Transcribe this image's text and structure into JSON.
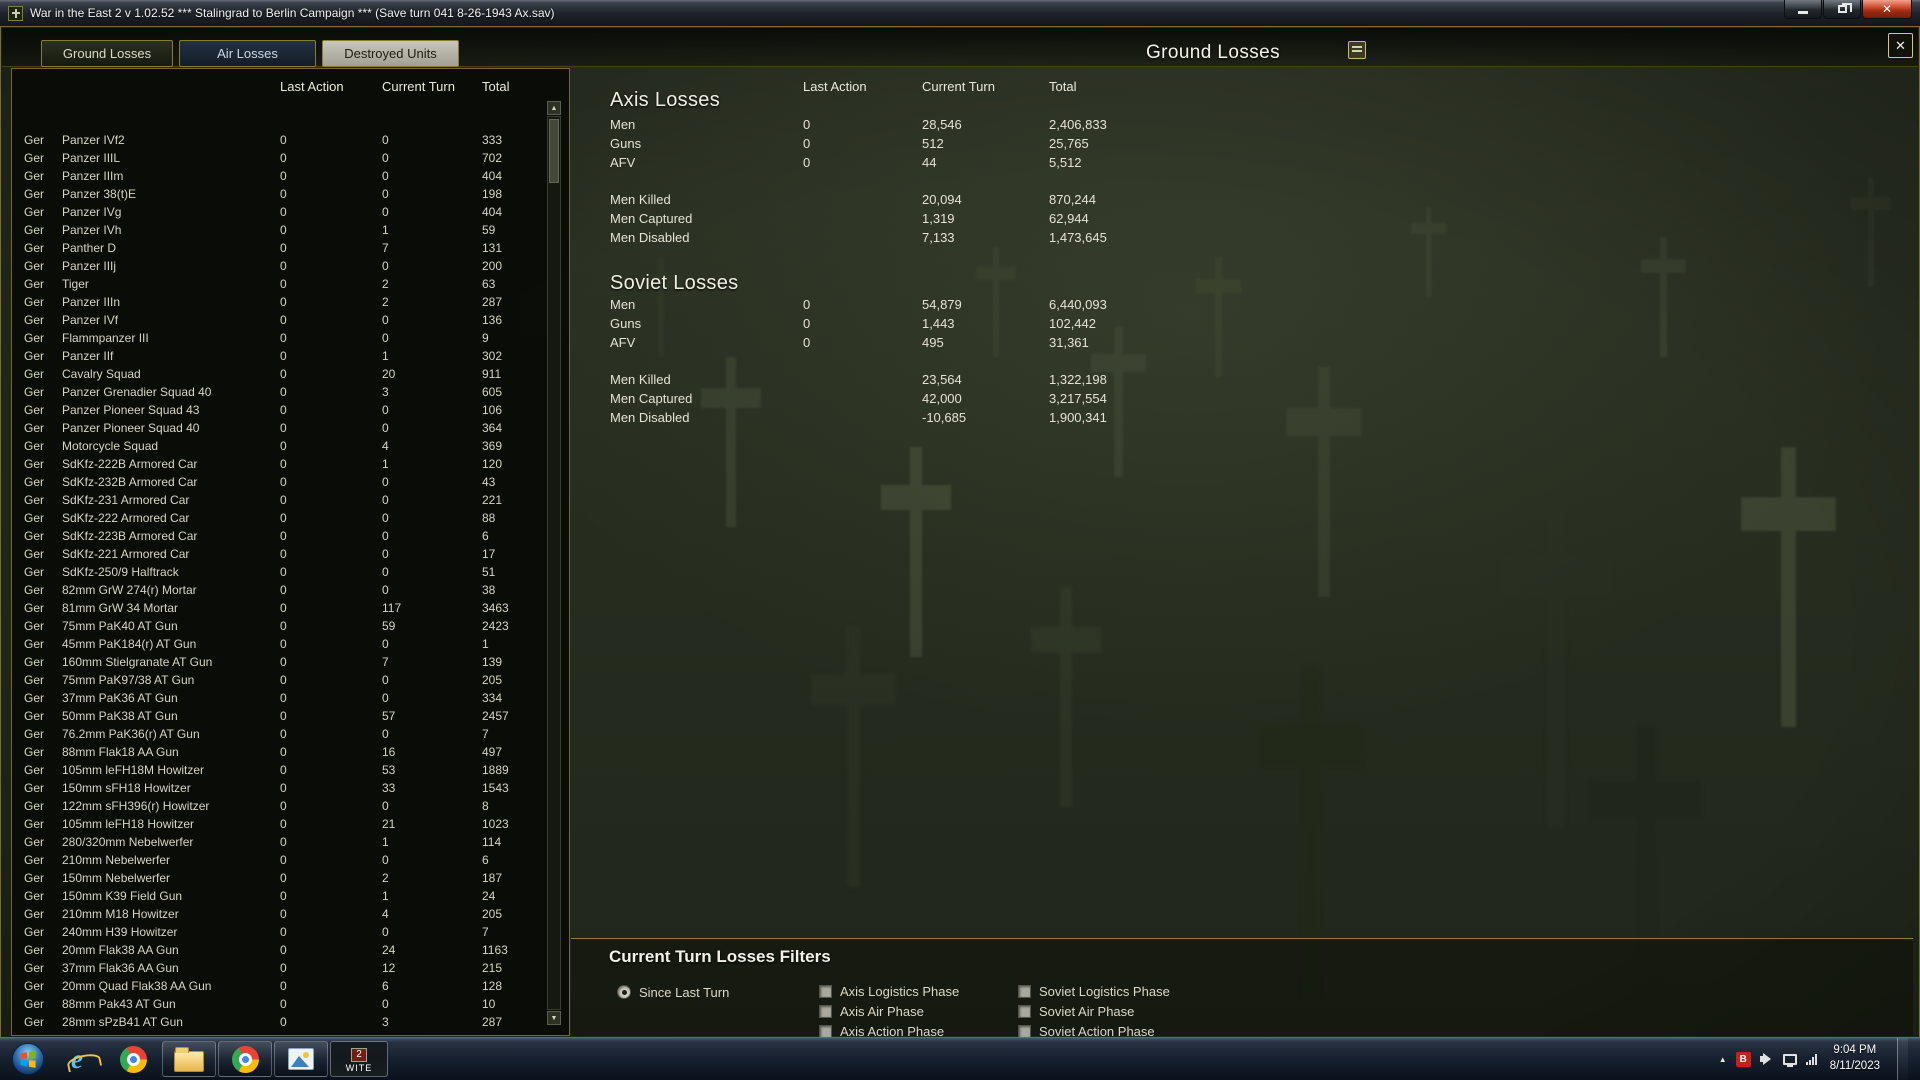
{
  "window": {
    "title": "War in the East 2  v 1.02.52    ***   Stalingrad to Berlin Campaign    ***    (Save turn 041 8-26-1943 Ax.sav)"
  },
  "icons": {
    "close": "✕",
    "scroll_up": "▲",
    "scroll_down": "▼",
    "tray_expand": "▲"
  },
  "header": {
    "tabs": [
      {
        "label": "Ground Losses"
      },
      {
        "label": "Air Losses"
      },
      {
        "label": "Destroyed Units"
      }
    ],
    "title": "Ground Losses"
  },
  "left_panel": {
    "columns": [
      "Last Action",
      "Current Turn",
      "Total"
    ],
    "rows": [
      {
        "nat": "Ger",
        "name": "Panzer IVf2",
        "la": "0",
        "ct": "0",
        "tot": "333"
      },
      {
        "nat": "Ger",
        "name": "Panzer IIIL",
        "la": "0",
        "ct": "0",
        "tot": "702"
      },
      {
        "nat": "Ger",
        "name": "Panzer IIIm",
        "la": "0",
        "ct": "0",
        "tot": "404"
      },
      {
        "nat": "Ger",
        "name": "Panzer 38(t)E",
        "la": "0",
        "ct": "0",
        "tot": "198"
      },
      {
        "nat": "Ger",
        "name": "Panzer IVg",
        "la": "0",
        "ct": "0",
        "tot": "404"
      },
      {
        "nat": "Ger",
        "name": "Panzer IVh",
        "la": "0",
        "ct": "1",
        "tot": "59"
      },
      {
        "nat": "Ger",
        "name": "Panther D",
        "la": "0",
        "ct": "7",
        "tot": "131"
      },
      {
        "nat": "Ger",
        "name": "Panzer IIIj",
        "la": "0",
        "ct": "0",
        "tot": "200"
      },
      {
        "nat": "Ger",
        "name": "Tiger",
        "la": "0",
        "ct": "2",
        "tot": "63"
      },
      {
        "nat": "Ger",
        "name": "Panzer IIIn",
        "la": "0",
        "ct": "2",
        "tot": "287"
      },
      {
        "nat": "Ger",
        "name": "Panzer IVf",
        "la": "0",
        "ct": "0",
        "tot": "136"
      },
      {
        "nat": "Ger",
        "name": "Flammpanzer III",
        "la": "0",
        "ct": "0",
        "tot": "9"
      },
      {
        "nat": "Ger",
        "name": "Panzer IIf",
        "la": "0",
        "ct": "1",
        "tot": "302"
      },
      {
        "nat": "Ger",
        "name": "Cavalry Squad",
        "la": "0",
        "ct": "20",
        "tot": "911"
      },
      {
        "nat": "Ger",
        "name": "Panzer Grenadier Squad 40",
        "la": "0",
        "ct": "3",
        "tot": "605"
      },
      {
        "nat": "Ger",
        "name": "Panzer Pioneer Squad 43",
        "la": "0",
        "ct": "0",
        "tot": "106"
      },
      {
        "nat": "Ger",
        "name": "Panzer Pioneer Squad 40",
        "la": "0",
        "ct": "0",
        "tot": "364"
      },
      {
        "nat": "Ger",
        "name": "Motorcycle Squad",
        "la": "0",
        "ct": "4",
        "tot": "369"
      },
      {
        "nat": "Ger",
        "name": "SdKfz-222B Armored Car",
        "la": "0",
        "ct": "1",
        "tot": "120"
      },
      {
        "nat": "Ger",
        "name": "SdKfz-232B Armored Car",
        "la": "0",
        "ct": "0",
        "tot": "43"
      },
      {
        "nat": "Ger",
        "name": "SdKfz-231 Armored Car",
        "la": "0",
        "ct": "0",
        "tot": "221"
      },
      {
        "nat": "Ger",
        "name": "SdKfz-222 Armored Car",
        "la": "0",
        "ct": "0",
        "tot": "88"
      },
      {
        "nat": "Ger",
        "name": "SdKfz-223B Armored Car",
        "la": "0",
        "ct": "0",
        "tot": "6"
      },
      {
        "nat": "Ger",
        "name": "SdKfz-221 Armored Car",
        "la": "0",
        "ct": "0",
        "tot": "17"
      },
      {
        "nat": "Ger",
        "name": "SdKfz-250/9 Halftrack",
        "la": "0",
        "ct": "0",
        "tot": "51"
      },
      {
        "nat": "Ger",
        "name": "82mm GrW 274(r) Mortar",
        "la": "0",
        "ct": "0",
        "tot": "38"
      },
      {
        "nat": "Ger",
        "name": "81mm GrW 34 Mortar",
        "la": "0",
        "ct": "117",
        "tot": "3463"
      },
      {
        "nat": "Ger",
        "name": "75mm PaK40 AT Gun",
        "la": "0",
        "ct": "59",
        "tot": "2423"
      },
      {
        "nat": "Ger",
        "name": "45mm PaK184(r) AT Gun",
        "la": "0",
        "ct": "0",
        "tot": "1"
      },
      {
        "nat": "Ger",
        "name": "160mm Stielgranate AT Gun",
        "la": "0",
        "ct": "7",
        "tot": "139"
      },
      {
        "nat": "Ger",
        "name": "75mm PaK97/38 AT Gun",
        "la": "0",
        "ct": "0",
        "tot": "205"
      },
      {
        "nat": "Ger",
        "name": "37mm PaK36 AT Gun",
        "la": "0",
        "ct": "0",
        "tot": "334"
      },
      {
        "nat": "Ger",
        "name": "50mm PaK38 AT Gun",
        "la": "0",
        "ct": "57",
        "tot": "2457"
      },
      {
        "nat": "Ger",
        "name": "76.2mm PaK36(r) AT Gun",
        "la": "0",
        "ct": "0",
        "tot": "7"
      },
      {
        "nat": "Ger",
        "name": "88mm Flak18 AA Gun",
        "la": "0",
        "ct": "16",
        "tot": "497"
      },
      {
        "nat": "Ger",
        "name": "105mm leFH18M Howitzer",
        "la": "0",
        "ct": "53",
        "tot": "1889"
      },
      {
        "nat": "Ger",
        "name": "150mm sFH18 Howitzer",
        "la": "0",
        "ct": "33",
        "tot": "1543"
      },
      {
        "nat": "Ger",
        "name": "122mm sFH396(r) Howitzer",
        "la": "0",
        "ct": "0",
        "tot": "8"
      },
      {
        "nat": "Ger",
        "name": "105mm leFH18 Howitzer",
        "la": "0",
        "ct": "21",
        "tot": "1023"
      },
      {
        "nat": "Ger",
        "name": "280/320mm Nebelwerfer",
        "la": "0",
        "ct": "1",
        "tot": "114"
      },
      {
        "nat": "Ger",
        "name": "210mm Nebelwerfer",
        "la": "0",
        "ct": "0",
        "tot": "6"
      },
      {
        "nat": "Ger",
        "name": "150mm Nebelwerfer",
        "la": "0",
        "ct": "2",
        "tot": "187"
      },
      {
        "nat": "Ger",
        "name": "150mm K39 Field Gun",
        "la": "0",
        "ct": "1",
        "tot": "24"
      },
      {
        "nat": "Ger",
        "name": "210mm M18 Howitzer",
        "la": "0",
        "ct": "4",
        "tot": "205"
      },
      {
        "nat": "Ger",
        "name": "240mm H39 Howitzer",
        "la": "0",
        "ct": "0",
        "tot": "7"
      },
      {
        "nat": "Ger",
        "name": "20mm Flak38 AA Gun",
        "la": "0",
        "ct": "24",
        "tot": "1163"
      },
      {
        "nat": "Ger",
        "name": "37mm Flak36 AA Gun",
        "la": "0",
        "ct": "12",
        "tot": "215"
      },
      {
        "nat": "Ger",
        "name": "20mm Quad Flak38 AA Gun",
        "la": "0",
        "ct": "6",
        "tot": "128"
      },
      {
        "nat": "Ger",
        "name": "88mm Pak43 AT Gun",
        "la": "0",
        "ct": "0",
        "tot": "10"
      },
      {
        "nat": "Ger",
        "name": "28mm sPzB41 AT Gun",
        "la": "0",
        "ct": "3",
        "tot": "287"
      }
    ]
  },
  "axis": {
    "title": "Axis Losses",
    "columns": [
      "Last Action",
      "Current Turn",
      "Total"
    ],
    "main_rows": [
      {
        "label": "Men",
        "la": "0",
        "ct": "28,546",
        "tot": "2,406,833"
      },
      {
        "label": "Guns",
        "la": "0",
        "ct": "512",
        "tot": "25,765"
      },
      {
        "label": "AFV",
        "la": "0",
        "ct": "44",
        "tot": "5,512"
      }
    ],
    "detail_rows": [
      {
        "label": "Men Killed",
        "ct": "20,094",
        "tot": "870,244"
      },
      {
        "label": "Men Captured",
        "ct": "1,319",
        "tot": "62,944"
      },
      {
        "label": "Men Disabled",
        "ct": "7,133",
        "tot": "1,473,645"
      }
    ]
  },
  "soviet": {
    "title": "Soviet Losses",
    "main_rows": [
      {
        "label": "Men",
        "la": "0",
        "ct": "54,879",
        "tot": "6,440,093"
      },
      {
        "label": "Guns",
        "la": "0",
        "ct": "1,443",
        "tot": "102,442"
      },
      {
        "label": "AFV",
        "la": "0",
        "ct": "495",
        "tot": "31,361"
      }
    ],
    "detail_rows": [
      {
        "label": "Men Killed",
        "ct": "23,564",
        "tot": "1,322,198"
      },
      {
        "label": "Men Captured",
        "ct": "42,000",
        "tot": "3,217,554"
      },
      {
        "label": "Men Disabled",
        "ct": "-10,685",
        "tot": "1,900,341"
      }
    ]
  },
  "filters": {
    "title": "Current Turn Losses Filters",
    "radio_label": "Since Last Turn",
    "radio_selected": true,
    "checkboxes": [
      "Axis Logistics Phase",
      "Axis Air Phase",
      "Axis Action Phase",
      "Soviet Logistics Phase",
      "Soviet Air Phase",
      "Soviet Action Phase"
    ]
  },
  "taskbar": {
    "wite_number": "2",
    "wite_label": "WITE",
    "tray_b": "B",
    "clock_time": "9:04 PM",
    "clock_date": "8/11/2023"
  },
  "colors": {
    "gold_border": "#8f7f34",
    "background_olive": "#272d1f",
    "close_red": "#9d2d12"
  }
}
